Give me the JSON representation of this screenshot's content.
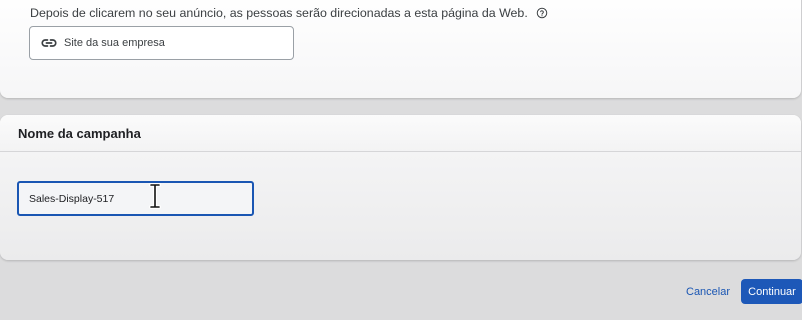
{
  "destination": {
    "description": "Depois de clicarem no seu anúncio, as pessoas serão direcionadas a esta página da Web.",
    "help_icon": "help-circle-icon",
    "url_icon": "link-icon",
    "url_value": "Site da sua empresa"
  },
  "campaign": {
    "title": "Nome da campanha",
    "name_value": "Sales-Display-517",
    "cursor_icon": "text-cursor-icon"
  },
  "footer": {
    "cancel_label": "Cancelar",
    "continue_label": "Continuar"
  },
  "colors": {
    "accent": "#1a56b3",
    "primary_button": "#1d58b8"
  }
}
